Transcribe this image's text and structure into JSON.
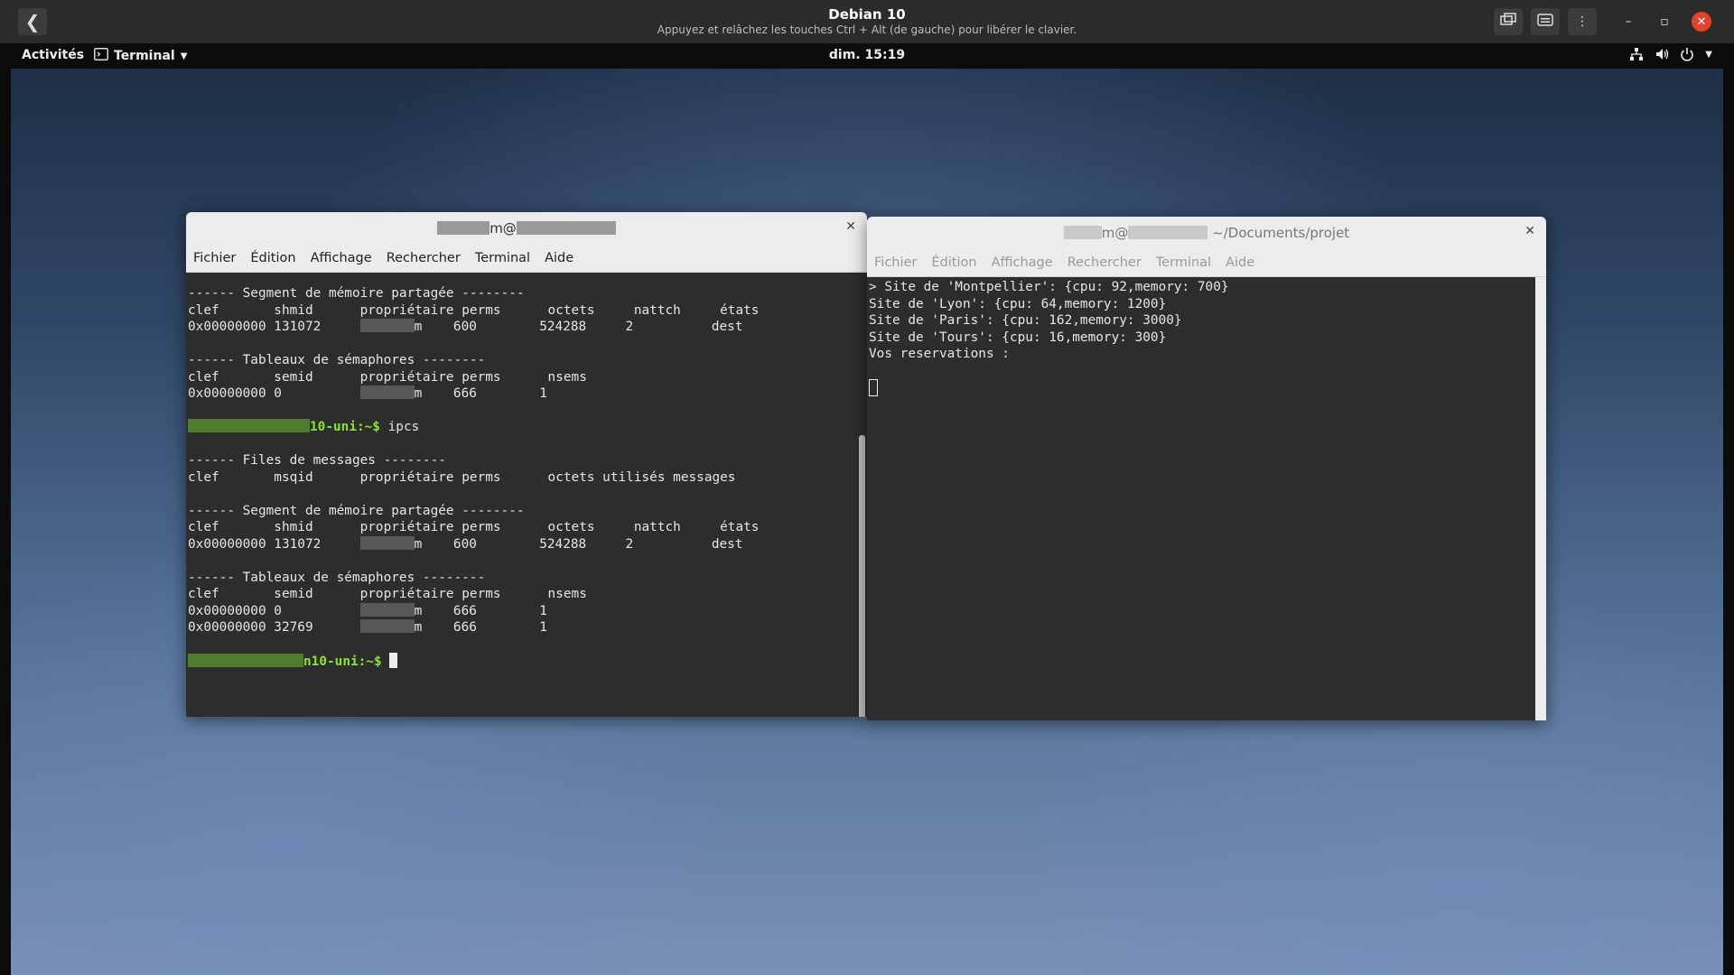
{
  "vm": {
    "title": "Debian 10",
    "subtitle": "Appuyez et relâchez les touches Ctrl + Alt (de gauche) pour libérer le clavier.",
    "back_glyph": "❮"
  },
  "gnome": {
    "activities": "Activités",
    "app_name": "Terminal",
    "clock": "dim. 15:19"
  },
  "term1": {
    "title_suffix": "m@",
    "menu": [
      "Fichier",
      "Édition",
      "Affichage",
      "Rechercher",
      "Terminal",
      "Aide"
    ],
    "lines": [
      "------ Segment de mémoire partagée --------",
      "clef       shmid      propriétaire perms      octets     nattch     états",
      "0x00000000 131072     ||||||m    600        524288     2          dest",
      "",
      "------ Tableaux de sémaphores --------",
      "clef       semid      propriétaire perms      nsems",
      "0x00000000 0          ||||||m    666        1",
      "",
      "@@PROMPT1@@",
      "",
      "------ Files de messages --------",
      "clef       msqid      propriétaire perms      octets utilisés messages",
      "",
      "------ Segment de mémoire partagée --------",
      "clef       shmid      propriétaire perms      octets     nattch     états",
      "0x00000000 131072     ||||||m    600        524288     2          dest",
      "",
      "------ Tableaux de sémaphores --------",
      "clef       semid      propriétaire perms      nsems",
      "0x00000000 0          ||||||m    666        1",
      "0x00000000 32769      ||||||m    666        1",
      "",
      "@@PROMPT2@@"
    ],
    "prompt1_host": "10-uni:~$ ",
    "prompt1_cmd": "ipcs",
    "prompt2_host": "n10-uni:~$ "
  },
  "term2": {
    "title_user": "m@",
    "title_path": " ~/Documents/projet",
    "menu": [
      "Fichier",
      "Édition",
      "Affichage",
      "Rechercher",
      "Terminal",
      "Aide"
    ],
    "lines": [
      "> Site de 'Montpellier': {cpu: 92,memory: 700}",
      "Site de 'Lyon': {cpu: 64,memory: 1200}",
      "Site de 'Paris': {cpu: 162,memory: 3000}",
      "Site de 'Tours': {cpu: 16,memory: 300}",
      "Vos reservations :",
      ""
    ]
  }
}
